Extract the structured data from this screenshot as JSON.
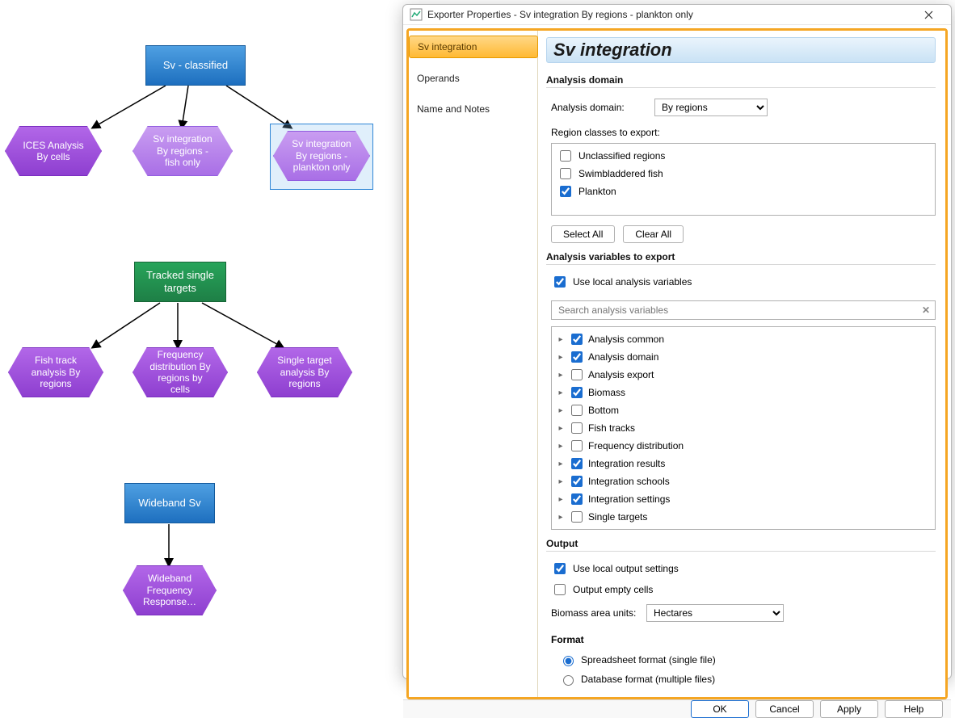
{
  "diagram": {
    "sv_classified": "Sv - classified",
    "ices": "ICES Analysis By cells",
    "sv_fish": "Sv integration By regions - fish only",
    "sv_plankton": "Sv integration By regions - plankton only",
    "tracked": "Tracked single targets",
    "fish_track": "Fish track analysis By regions",
    "freq_dist": "Frequency distribution By regions by cells",
    "single_target": "Single target analysis By regions",
    "wideband": "Wideband Sv",
    "wideband_freq": "Wideband Frequency Response…"
  },
  "dialog": {
    "title": "Exporter Properties - Sv integration By regions - plankton only",
    "tabs": {
      "sv_integration": "Sv integration",
      "operands": "Operands",
      "name_notes": "Name and Notes"
    },
    "panel_title": "Sv integration",
    "analysis_domain": {
      "heading": "Analysis domain",
      "label": "Analysis domain:",
      "value": "By regions",
      "region_label": "Region classes to export:",
      "regions": [
        {
          "label": "Unclassified regions",
          "checked": false
        },
        {
          "label": "Swimbladdered fish",
          "checked": false
        },
        {
          "label": "Plankton",
          "checked": true
        }
      ],
      "select_all": "Select All",
      "clear_all": "Clear All"
    },
    "analysis_vars": {
      "heading": "Analysis variables to export",
      "use_local": "Use local analysis variables",
      "search_placeholder": "Search analysis variables",
      "tree": [
        {
          "label": "Analysis common",
          "checked": true
        },
        {
          "label": "Analysis domain",
          "checked": true
        },
        {
          "label": "Analysis export",
          "checked": false
        },
        {
          "label": "Biomass",
          "checked": true
        },
        {
          "label": "Bottom",
          "checked": false
        },
        {
          "label": "Fish tracks",
          "checked": false
        },
        {
          "label": "Frequency distribution",
          "checked": false
        },
        {
          "label": "Integration results",
          "checked": true
        },
        {
          "label": "Integration schools",
          "checked": true
        },
        {
          "label": "Integration settings",
          "checked": true
        },
        {
          "label": "Single targets",
          "checked": false
        }
      ]
    },
    "output": {
      "heading": "Output",
      "use_local": "Use local output settings",
      "output_empty": "Output empty cells",
      "biomass_label": "Biomass area units:",
      "biomass_value": "Hectares",
      "format_heading": "Format",
      "radio_spreadsheet": "Spreadsheet format (single file)",
      "radio_database": "Database format (multiple files)"
    },
    "buttons": {
      "ok": "OK",
      "cancel": "Cancel",
      "apply": "Apply",
      "help": "Help"
    }
  }
}
